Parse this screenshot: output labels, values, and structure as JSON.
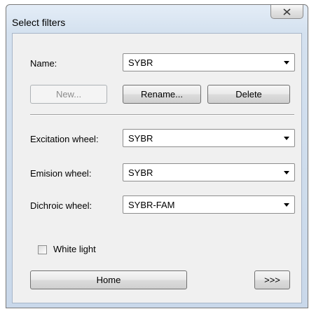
{
  "dialog": {
    "title": "Select filters",
    "close_icon": "close-x-icon"
  },
  "name": {
    "label": "Name:",
    "value": "SYBR"
  },
  "buttons": {
    "new": "New...",
    "rename": "Rename...",
    "delete": "Delete",
    "home": "Home",
    "next": ">>>"
  },
  "excitation": {
    "label": "Excitation wheel:",
    "value": "SYBR"
  },
  "emision": {
    "label": "Emision wheel:",
    "value": "SYBR"
  },
  "dichroic": {
    "label": "Dichroic wheel:",
    "value": "SYBR-FAM"
  },
  "white_light": {
    "label": "White light",
    "checked": false
  }
}
